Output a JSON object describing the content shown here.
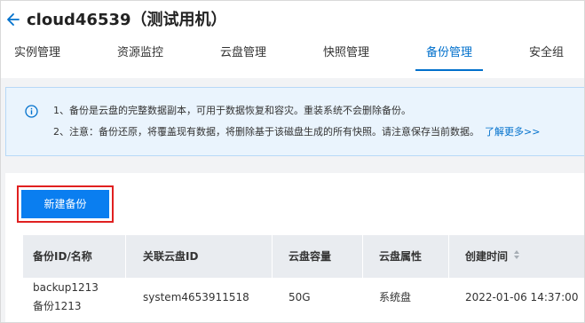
{
  "header": {
    "back_icon": "arrow-left-icon",
    "title": "cloud46539（测试用机）"
  },
  "tabs": [
    {
      "label": "实例管理"
    },
    {
      "label": "资源监控"
    },
    {
      "label": "云盘管理"
    },
    {
      "label": "快照管理"
    },
    {
      "label": "备份管理",
      "active": true
    },
    {
      "label": "安全组"
    }
  ],
  "notice": {
    "icon": "info-circle-icon",
    "line1": "1、备份是云盘的完整数据副本，可用于数据恢复和容灾。重装系统不会删除备份。",
    "line2": "2、注意：备份还原，将覆盖现有数据，将删除基于该磁盘生成的所有快照。请注意保存当前数据。",
    "more_link": "了解更多>>",
    "accent": "#0070cc"
  },
  "toolbar": {
    "new_backup_label": "新建备份",
    "button_color": "#0a7ef0",
    "highlight_color": "#e02020"
  },
  "table": {
    "columns": [
      "备份ID/名称",
      "关联云盘ID",
      "云盘容量",
      "云盘属性",
      "创建时间"
    ],
    "sortable_column_icon": "sort-icon",
    "rows": [
      {
        "id": "backup1213",
        "name": "备份1213",
        "disk_id": "system4653911518",
        "capacity": "50G",
        "attribute": "系统盘",
        "created": "2022-01-06 14:37:00"
      }
    ]
  }
}
